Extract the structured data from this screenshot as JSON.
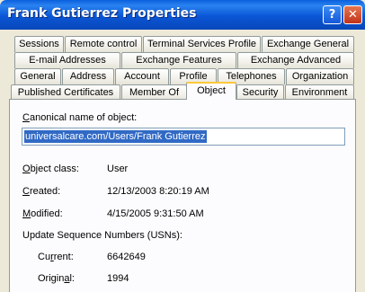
{
  "window": {
    "title": "Frank Gutierrez Properties"
  },
  "titlebar": {
    "help_label": "?",
    "close_label": "✕"
  },
  "tabs_row1": [
    "Sessions",
    "Remote control",
    "Terminal Services Profile",
    "Exchange General"
  ],
  "tabs_row2": [
    "E-mail Addresses",
    "Exchange Features",
    "Exchange Advanced"
  ],
  "tabs_row3": [
    "General",
    "Address",
    "Account",
    "Profile",
    "Telephones",
    "Organization"
  ],
  "tabs_row4": [
    "Published Certificates",
    "Member Of",
    "Object",
    "Security",
    "Environment"
  ],
  "active_tab": "Object",
  "object": {
    "canonical_label_key": "C",
    "canonical_label_rest": "anonical name of object:",
    "canonical_value": "universalcare.com/Users/Frank Gutierrez",
    "class_label_key": "O",
    "class_label_rest": "bject class:",
    "class_value": "User",
    "created_label_key": "C",
    "created_label_rest": "reated:",
    "created_value": "12/13/2003 8:20:19 AM",
    "modified_label_key": "M",
    "modified_label_rest": "odified:",
    "modified_value": "4/15/2005 9:31:50 AM",
    "usn_heading": "Update Sequence Numbers (USNs):",
    "current_label_pre": "Cu",
    "current_label_key": "r",
    "current_label_post": "rent:",
    "current_value": "6642649",
    "original_label_pre": "Origin",
    "original_label_key": "a",
    "original_label_post": "l:",
    "original_value": "1994"
  }
}
